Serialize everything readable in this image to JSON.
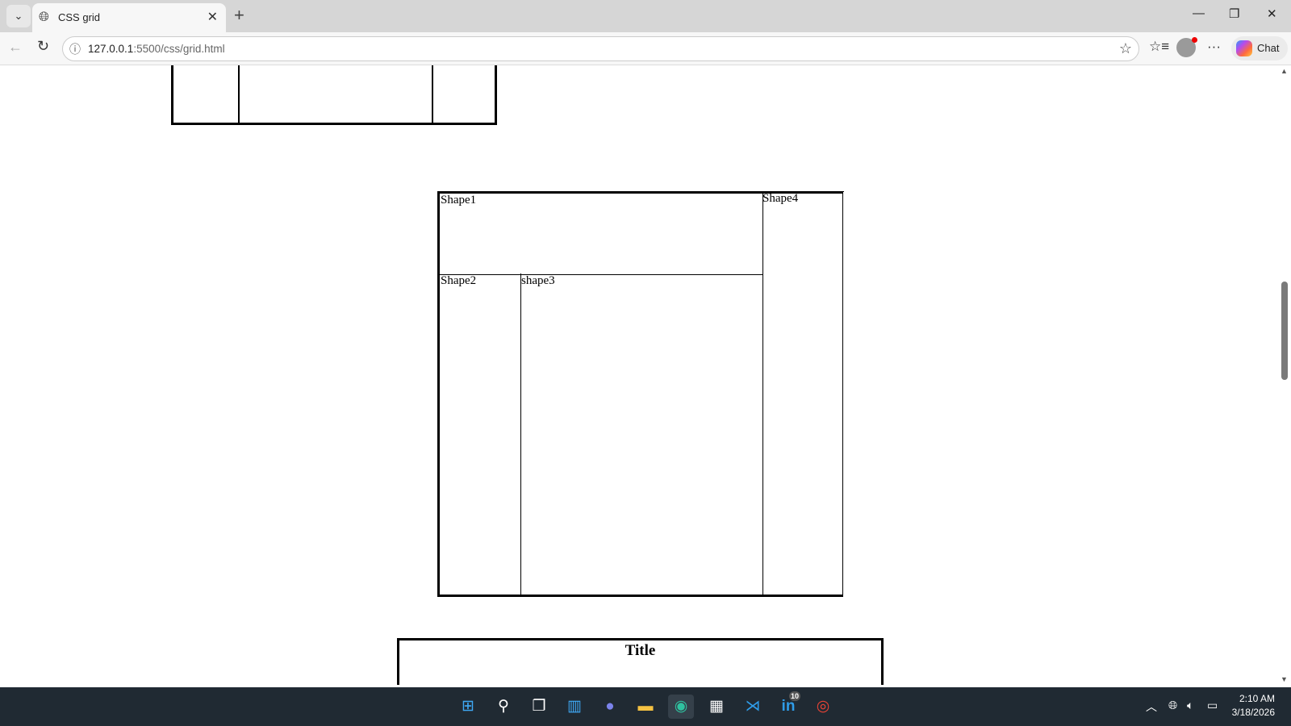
{
  "browser": {
    "tab": {
      "title": "CSS grid",
      "icon": "globe-icon"
    },
    "url_host": "127.0.0.1",
    "url_rest": ":5500/css/grid.html",
    "chat_label": "Chat"
  },
  "page": {
    "grid": {
      "shape1": "Shape1",
      "shape2": "Shape2",
      "shape3": "shape3",
      "shape4": "Shape4"
    },
    "title_box": {
      "title": "Title"
    }
  },
  "taskbar": {
    "linkedin_badge": "10",
    "time": "2:10 AM",
    "date": "3/18/2026"
  }
}
